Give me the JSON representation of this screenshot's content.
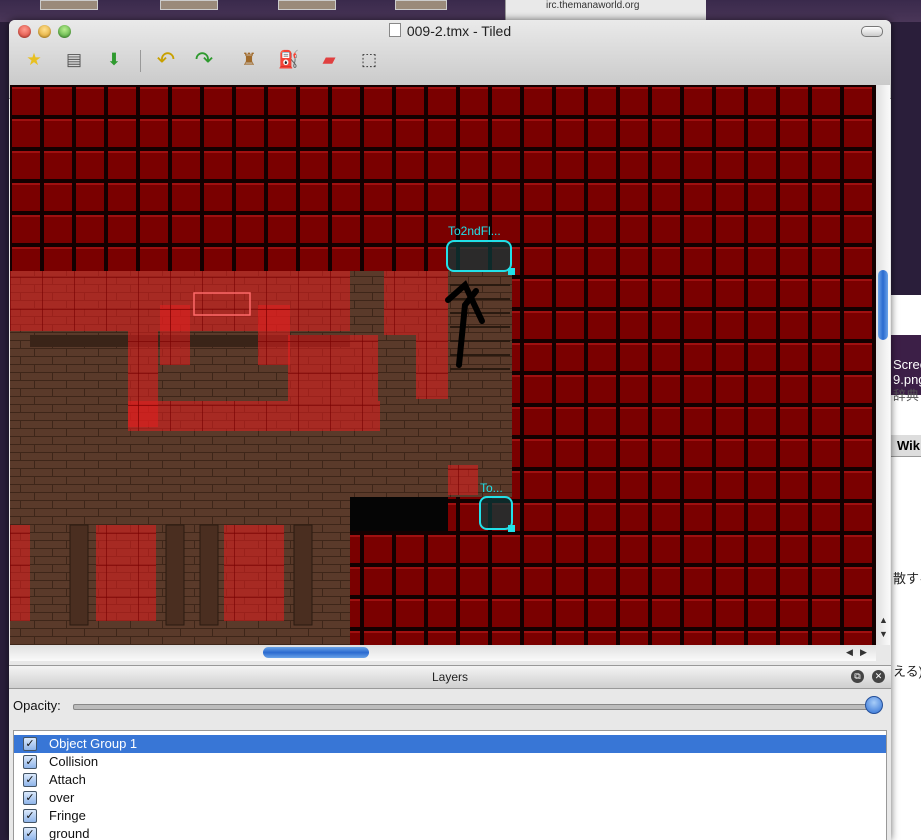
{
  "desktop": {
    "browser_url": "irc.themanaworld.org"
  },
  "background_window": {
    "lines": [
      "Scree",
      "9.png",
      "辞典",
      "Wik",
      "散すろ",
      "える)"
    ]
  },
  "window": {
    "title": "009-2.tmx - Tiled"
  },
  "toolbar": {
    "items": [
      {
        "name": "new-map",
        "icon": "new-document-icon",
        "glyph": "★"
      },
      {
        "name": "open-map",
        "icon": "open-folder-icon",
        "glyph": "▤"
      },
      {
        "name": "save-map",
        "icon": "save-download-icon",
        "glyph": "⬇"
      },
      {
        "name": "undo",
        "icon": "undo-arrow-icon",
        "glyph": "↶"
      },
      {
        "name": "redo",
        "icon": "redo-arrow-icon",
        "glyph": "↷"
      },
      {
        "name": "stamp-brush",
        "icon": "stamp-icon",
        "glyph": "♜"
      },
      {
        "name": "bucket-fill",
        "icon": "paint-bucket-icon",
        "glyph": "⛽"
      },
      {
        "name": "eraser",
        "icon": "eraser-icon",
        "glyph": "▰"
      },
      {
        "name": "rect-select",
        "icon": "rectangle-select-icon",
        "glyph": "⬚"
      }
    ]
  },
  "map": {
    "objects": [
      {
        "label": "To2ndFl..."
      },
      {
        "label": "To..."
      }
    ]
  },
  "layers_panel": {
    "title": "Layers",
    "opacity_label": "Opacity:",
    "opacity": 1.0,
    "layers": [
      {
        "name": "Object Group 1",
        "visible": true,
        "selected": true
      },
      {
        "name": "Collision",
        "visible": true,
        "selected": false
      },
      {
        "name": "Attach",
        "visible": true,
        "selected": false
      },
      {
        "name": "over",
        "visible": true,
        "selected": false
      },
      {
        "name": "Fringe",
        "visible": true,
        "selected": false
      },
      {
        "name": "ground",
        "visible": true,
        "selected": false
      }
    ]
  },
  "colors": {
    "collision_red": "#7a0000",
    "object_cyan": "#22e0e8",
    "selection_blue": "#3876d6"
  }
}
